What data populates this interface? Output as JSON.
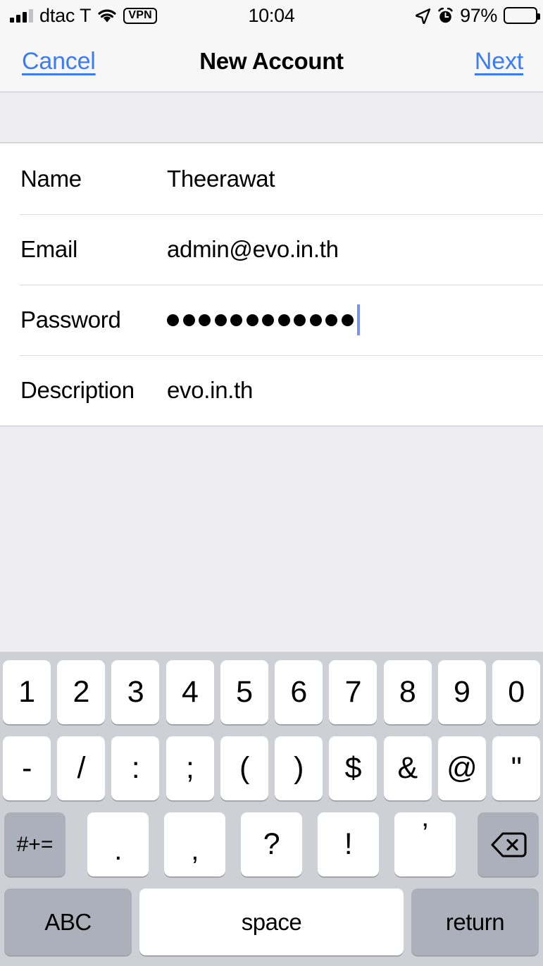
{
  "status_bar": {
    "carrier": "dtac T",
    "signal_bars_filled": 3,
    "signal_bars_total": 4,
    "wifi_icon": "wifi-icon",
    "vpn_badge": "VPN",
    "time": "10:04",
    "location_icon": "location-arrow-icon",
    "alarm_icon": "alarm-clock-icon",
    "battery_percent": "97%",
    "battery_level": 97
  },
  "nav_bar": {
    "cancel_label": "Cancel",
    "title": "New Account",
    "next_label": "Next",
    "accent_color": "#3a7cf8"
  },
  "form": {
    "rows": [
      {
        "label": "Name",
        "value": "Theerawat",
        "secure": false,
        "focused": false
      },
      {
        "label": "Email",
        "value": "admin@evo.in.th",
        "secure": false,
        "focused": false
      },
      {
        "label": "Password",
        "value": "",
        "secure": true,
        "dot_count": 12,
        "focused": true
      },
      {
        "label": "Description",
        "value": "evo.in.th",
        "secure": false,
        "focused": false
      }
    ]
  },
  "keyboard": {
    "type": "numbers-symbols",
    "row1": [
      "1",
      "2",
      "3",
      "4",
      "5",
      "6",
      "7",
      "8",
      "9",
      "0"
    ],
    "row2": [
      "-",
      "/",
      ":",
      ";",
      "(",
      ")",
      "$",
      "&",
      "@",
      "\""
    ],
    "row3": {
      "symbols_key": "#+=",
      "keys": [
        ".",
        ",",
        "?",
        "!",
        "’"
      ],
      "backspace_icon": "backspace-icon"
    },
    "row4": {
      "abc_label": "ABC",
      "space_label": "space",
      "return_label": "return"
    },
    "key_bg": "#ffffff",
    "modifier_bg": "#acb0ba",
    "keyboard_bg": "#ced0d6"
  }
}
